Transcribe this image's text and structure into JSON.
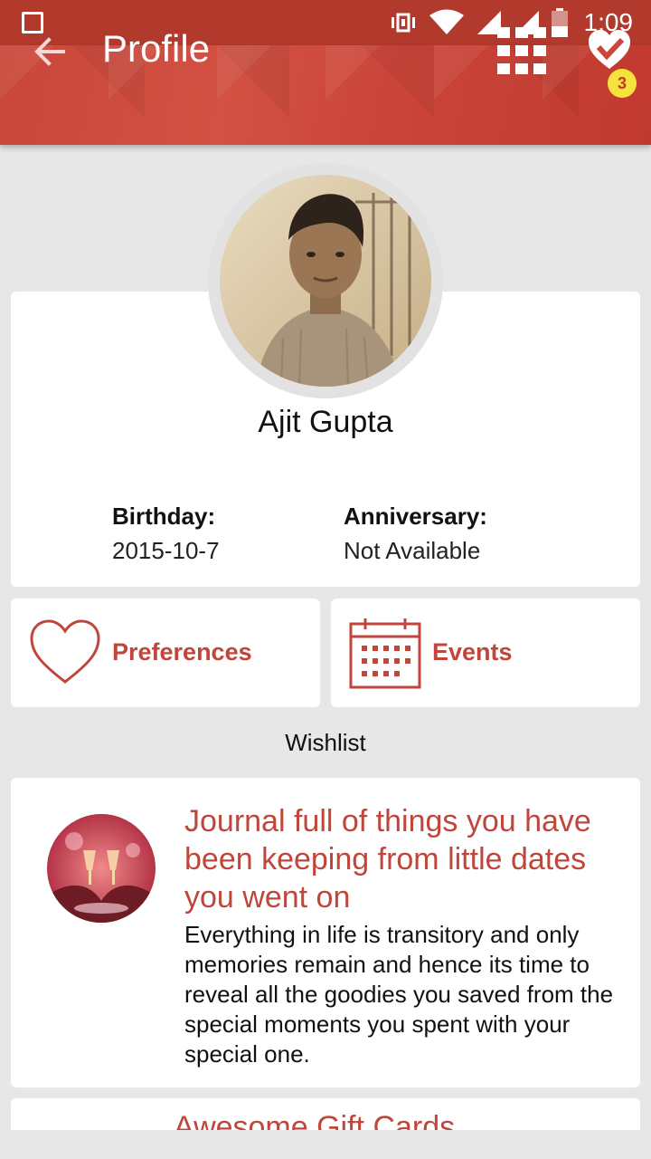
{
  "status_bar": {
    "time": "1:09",
    "icons": [
      "notification-square-icon",
      "vibrate-icon",
      "wifi-icon",
      "signal-icon",
      "signal-icon",
      "battery-icon"
    ]
  },
  "app_bar": {
    "title": "Profile",
    "back_icon": "arrow-left-icon",
    "grid_icon": "apps-grid-icon",
    "heart_icon": "heart-check-icon",
    "badge_count": "3",
    "colors": {
      "primary": "#c9473a",
      "status": "#b23a2d",
      "badge": "#f5e23c"
    }
  },
  "profile": {
    "name": "Ajit Gupta",
    "birthday_label": "Birthday:",
    "birthday_value": "2015-10-7",
    "anniversary_label": "Anniversary:",
    "anniversary_value": "Not Available"
  },
  "actions": {
    "preferences_label": "Preferences",
    "events_label": "Events"
  },
  "wishlist": {
    "title": "Wishlist",
    "items": [
      {
        "title": "Journal full of things you have been keeping from little dates you went on",
        "description": "Everything in life is transitory and only memories remain and hence its time to reveal all the goodies you saved from the special moments you spent with your special one."
      },
      {
        "title": "Awesome Gift Cards"
      }
    ]
  }
}
